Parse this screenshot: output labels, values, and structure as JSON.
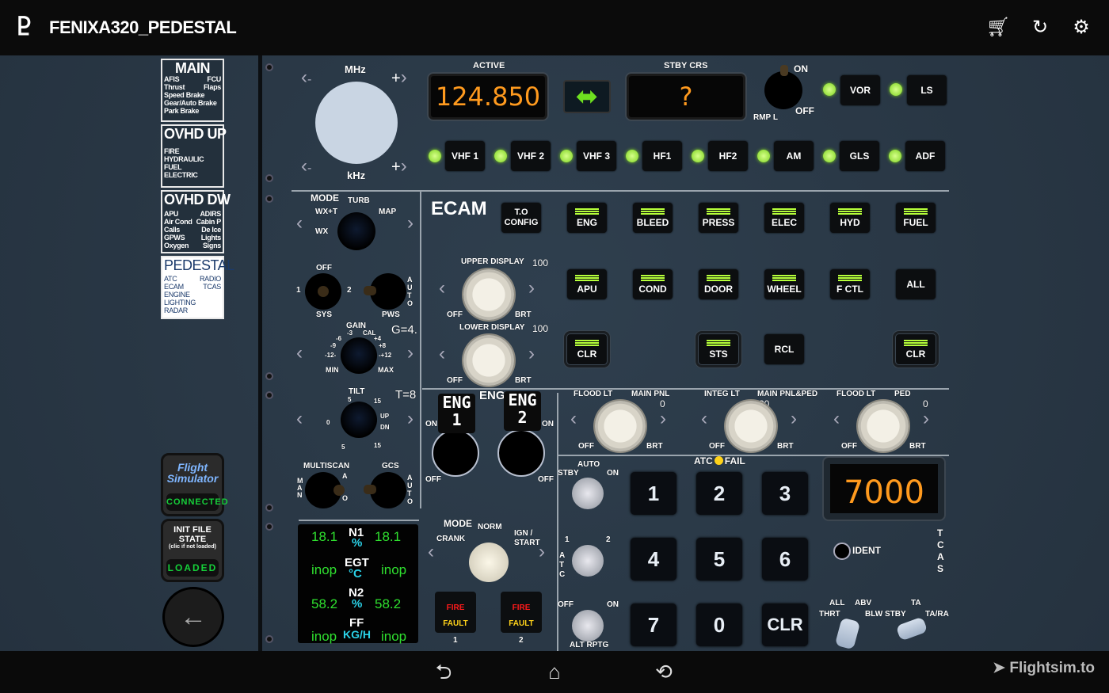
{
  "header": {
    "title": "FENIXA320_PEDESTAL",
    "logo": "logo-icon",
    "icons": [
      "cart-icon",
      "refresh-icon",
      "settings-icon"
    ]
  },
  "sidebar": {
    "main": {
      "title": "MAIN",
      "rows": [
        [
          "AFIS",
          "FCU"
        ],
        [
          "Thrust",
          "Flaps"
        ],
        [
          "Speed Brake",
          ""
        ],
        [
          "Gear/Auto Brake",
          ""
        ],
        [
          "Park Brake",
          ""
        ]
      ]
    },
    "ovhd_up": {
      "title": "OVHD UP",
      "rows": [
        "FIRE",
        "HYDRAULIC",
        "FUEL",
        "ELECTRIC"
      ]
    },
    "ovhd_dw": {
      "title": "OVHD DW",
      "rows": [
        [
          "APU",
          "ADIRS"
        ],
        [
          "Air Cond",
          "Cabin P"
        ],
        [
          "Calls",
          "De Ice"
        ],
        [
          "GPWS",
          "Lights"
        ],
        [
          "Oxygen",
          "Signs"
        ]
      ]
    },
    "pedestal": {
      "title": "PEDESTAL",
      "rows": [
        [
          "ATC",
          "RADIO"
        ],
        [
          "ECAM",
          "TCAS"
        ],
        [
          "ENGINE",
          ""
        ],
        [
          "LIGHTING",
          ""
        ],
        [
          "RADAR",
          ""
        ]
      ]
    },
    "connection": {
      "logo": "Flight Simulator",
      "status": "CONNECTED"
    },
    "init": {
      "title1": "INIT FILE",
      "title2": "STATE",
      "hint": "(clic if not loaded)",
      "status": "LOADED"
    }
  },
  "radio": {
    "mhz": "MHz",
    "khz": "kHz",
    "minus": "-",
    "plus": "+",
    "active_label": "ACTIVE",
    "active": "124.850",
    "stby_label": "STBY CRS",
    "stby": "?",
    "on": "ON",
    "off": "OFF",
    "rmp": "RMP L",
    "top_buttons": [
      "VOR",
      "LS"
    ],
    "buttons": [
      "VHF 1",
      "VHF 2",
      "VHF 3",
      "HF1",
      "HF2",
      "AM",
      "GLS",
      "ADF"
    ]
  },
  "radar": {
    "mode": "MODE",
    "turb": "TURB",
    "wxt": "WX+T",
    "map": "MAP",
    "wx": "WX",
    "off": "OFF",
    "one": "1",
    "two": "2",
    "sys": "SYS",
    "pws": "PWS",
    "auto": "AUTO",
    "of": "OF",
    "gain": "GAIN",
    "gain_value": "G=4.",
    "gain_ticks": [
      "-3",
      "CAL",
      "-6",
      "+4",
      "-9",
      "+8",
      "-12-",
      "-+12",
      "MIN",
      "MAX"
    ],
    "tilt": "TILT",
    "tilt_value": "T=8",
    "tilt_ticks": [
      "5",
      "15",
      "0",
      "UP",
      "DN",
      "5",
      "15"
    ],
    "multiscan": "MULTISCAN",
    "man": "MAN",
    "ao": "A",
    "o": "O",
    "gcs": "GCS"
  },
  "ecam": {
    "title": "ECAM",
    "to_config": [
      "T.O",
      "CONFIG"
    ],
    "row1": [
      "ENG",
      "BLEED",
      "PRESS",
      "ELEC",
      "HYD",
      "FUEL"
    ],
    "row2": [
      "APU",
      "COND",
      "DOOR",
      "WHEEL",
      "F  CTL",
      "ALL"
    ],
    "row3": [
      "CLR",
      "STS",
      "RCL",
      "CLR"
    ],
    "upper": {
      "label": "UPPER DISPLAY",
      "value": "100",
      "off": "OFF",
      "brt": "BRT"
    },
    "lower": {
      "label": "LOWER DISPLAY",
      "value": "100",
      "off": "OFF",
      "brt": "BRT"
    }
  },
  "engine": {
    "label": "ENG",
    "eng1": [
      "ENG",
      "1"
    ],
    "eng2": [
      "ENG",
      "2"
    ],
    "on": "ON",
    "off": "OFF",
    "display": {
      "n1": "N1",
      "pct": "%",
      "n1_l": "18.1",
      "n1_r": "18.1",
      "egt": "EGT",
      "degc": "°C",
      "egt_l": "inop",
      "egt_r": "inop",
      "n2": "N2",
      "n2_l": "58.2",
      "n2_r": "58.2",
      "ff": "FF",
      "kgh": "KG/H",
      "ff_l": "inop",
      "ff_r": "inop"
    },
    "mode": "MODE",
    "norm": "NORM",
    "crank": "CRANK",
    "ign": "IGN /",
    "start": "START",
    "fire": "FIRE",
    "fault": "FAULT",
    "n1num": "1",
    "n2num": "2"
  },
  "lighting": [
    {
      "left": "FLOOD LT",
      "right": "MAIN PNL",
      "value": "0",
      "off": "OFF",
      "brt": "BRT"
    },
    {
      "left": "INTEG LT",
      "right": "MAIN PNL&PED",
      "value": "30",
      "off": "OFF",
      "brt": "BRT"
    },
    {
      "left": "FLOOD LT",
      "right": "PED",
      "value": "0",
      "off": "OFF",
      "brt": "BRT"
    }
  ],
  "atc": {
    "fail": "FAIL",
    "atc": "ATC",
    "auto": "AUTO",
    "stby": "STBY",
    "on": "ON",
    "one": "1",
    "two": "2",
    "atc_v": "ATC",
    "off": "OFF",
    "alt_rptg": "ALT RPTG",
    "code": "7000",
    "ident": "IDENT",
    "keys": [
      "1",
      "2",
      "3",
      "4",
      "5",
      "6",
      "7",
      "0",
      "CLR"
    ],
    "tcas": "TCAS",
    "all": "ALL",
    "abv": "ABV",
    "thrt": "THRT",
    "blw": "BLW",
    "stby2": "STBY",
    "ta": "TA",
    "tara": "TA/RA"
  },
  "watermark": "Flightsim.to",
  "colors": {
    "active_display": "#ff9a1e",
    "led": "#7ed321",
    "ecam_text": "#2fe02f",
    "ecam_unit": "#2bd2e8",
    "fire": "#ff1a1a",
    "fault": "#ffd21a"
  }
}
